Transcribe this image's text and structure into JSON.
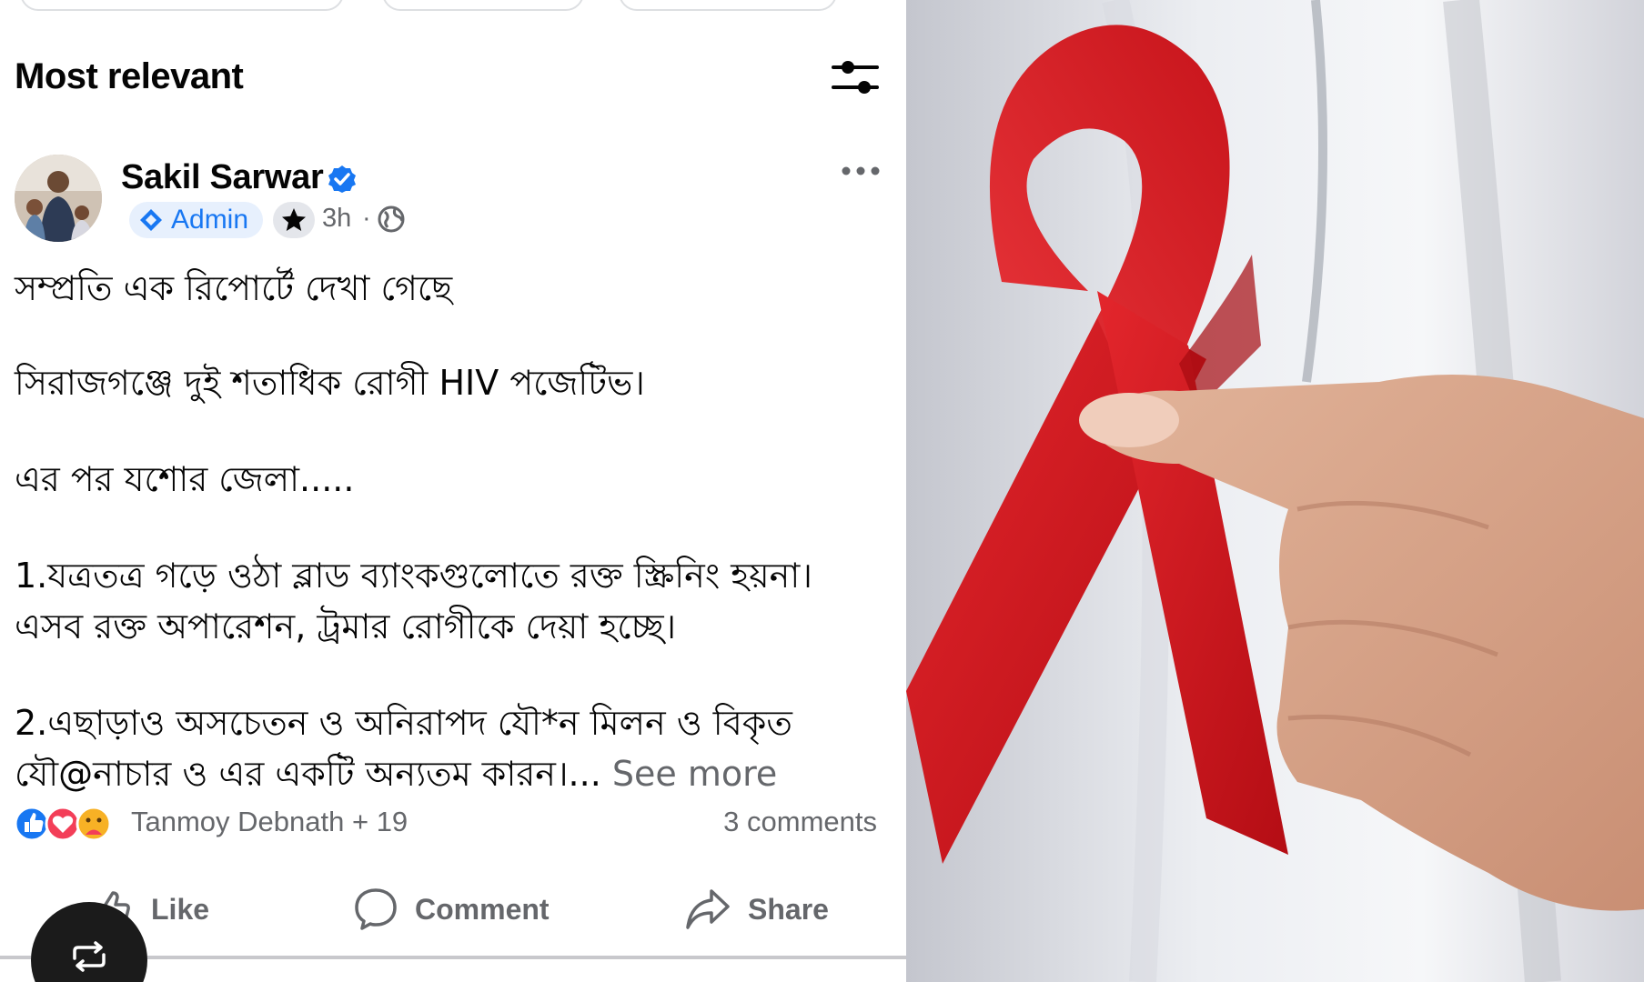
{
  "sort": {
    "title": "Most relevant",
    "filter_icon": "sliders-icon"
  },
  "post": {
    "author": "Sakil Sarwar",
    "badge": "Admin",
    "time": "3h",
    "separator": "·",
    "lines": [
      "সম্প্রতি এক রিপোর্টে দেখা গেছে",
      "সিরাজগঞ্জে দুই শতাধিক রোগী HIV পজেটিভ।",
      "এর পর যশোর জেলা.....",
      "1.যত্রতত্র গড়ে ওঠা ব্লাড ব্যাংকগুলোতে রক্ত স্ক্রিনিং হয়না।",
      "এসব রক্ত অপারেশন, ট্রমার রোগীকে দেয়া হচ্ছে।",
      "2.এছাড়াও অসচেতন ও অনিরাপদ যৌ*ন মিলন ও বিকৃত",
      "যৌ@নাচার ও এর একটি অন্যতম কারন।..."
    ],
    "see_more": "See more",
    "reactors": "Tanmoy Debnath + 19",
    "comments": "3 comments"
  },
  "actions": {
    "like": "Like",
    "comment": "Comment",
    "share": "Share"
  },
  "colors": {
    "accent": "#1877f2",
    "love": "#f33e58",
    "ribbon": "#d4121b"
  }
}
